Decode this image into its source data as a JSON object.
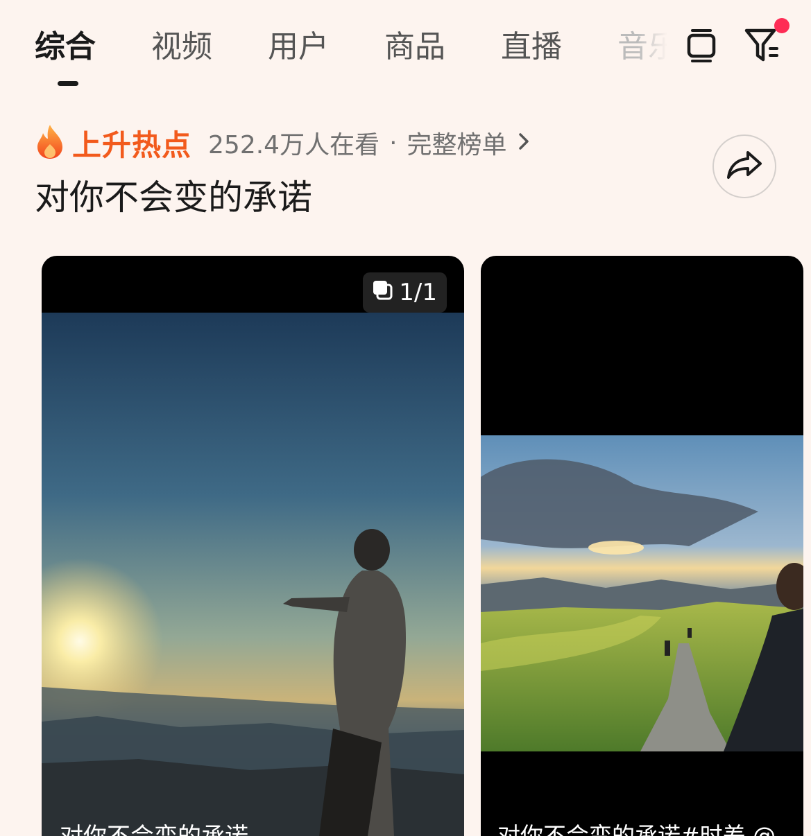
{
  "tabs": [
    {
      "label": "综合",
      "active": true
    },
    {
      "label": "视频",
      "active": false
    },
    {
      "label": "用户",
      "active": false
    },
    {
      "label": "商品",
      "active": false
    },
    {
      "label": "直播",
      "active": false
    },
    {
      "label": "音乐",
      "active": false
    }
  ],
  "toolbar": {
    "layout_icon": "card-layout-icon",
    "filter_icon": "filter-icon",
    "filter_has_notification": true
  },
  "hot_topic": {
    "icon": "fire-icon",
    "label": "上升热点",
    "viewers": "252.4万人在看",
    "separator": "·",
    "full_list": "完整榜单",
    "title": "对你不会变的承诺"
  },
  "cards": [
    {
      "badge": "1/1",
      "caption": "对你不会变的承诺"
    },
    {
      "caption": "对你不会变的承诺#时差 @"
    }
  ],
  "colors": {
    "background": "#fdf4ef",
    "hot_accent": "#f25a1c",
    "notification": "#fe2c55"
  }
}
